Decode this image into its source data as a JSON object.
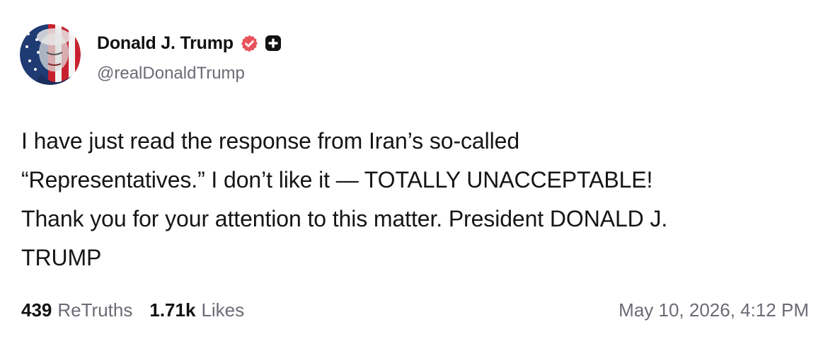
{
  "post": {
    "author": {
      "display_name": "Donald J. Trump",
      "handle": "@realDonaldTrump",
      "verified_icon": "verified-badge-icon",
      "extra_icon": "plus-square-icon"
    },
    "text": "I have just read the response from Iran’s so-called\n“Representatives.” I don’t like it — TOTALLY UNACCEPTABLE!\nThank you for your attention to this matter. President DONALD J.\nTRUMP",
    "stats": {
      "retruths_count": "439",
      "retruths_label": "ReTruths",
      "likes_count": "1.71k",
      "likes_label": "Likes"
    },
    "timestamp": "May 10, 2026, 4:12 PM"
  },
  "colors": {
    "verified_badge": "#e8545c",
    "secondary_text": "#6b6b75",
    "primary_text": "#111111"
  }
}
